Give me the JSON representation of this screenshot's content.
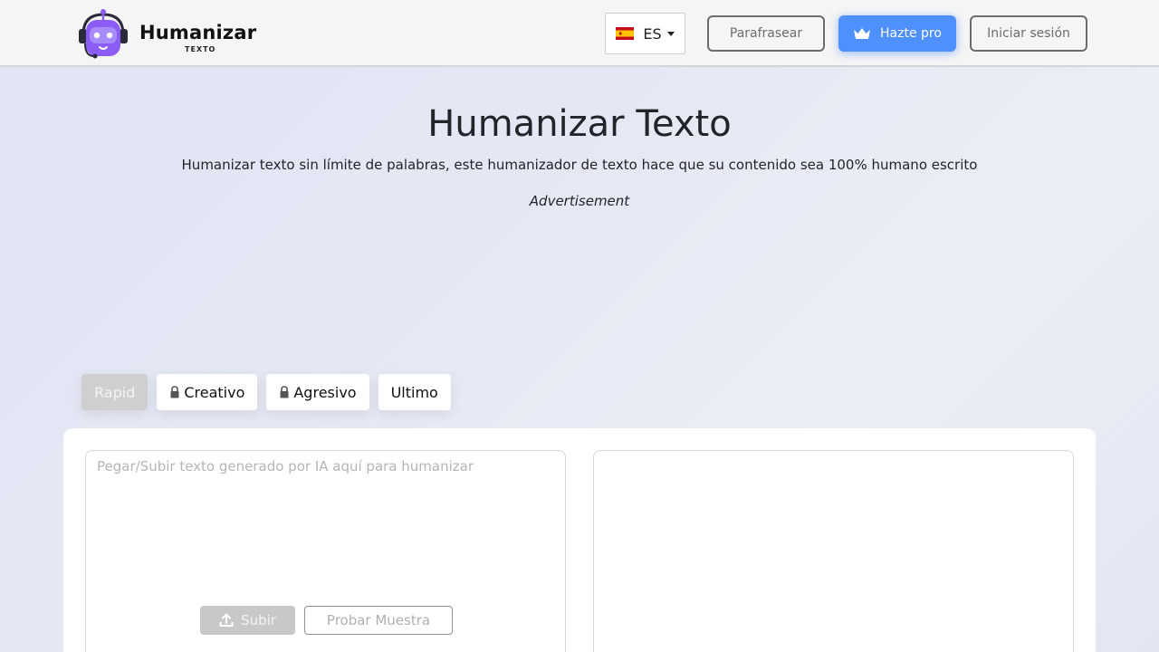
{
  "header": {
    "logo": {
      "name": "Humanizar",
      "subtitle": "TEXTO"
    },
    "language": {
      "code": "ES"
    },
    "paraphrase_label": "Parafrasear",
    "pro_label": "Hazte pro",
    "login_label": "Iniciar sesión"
  },
  "hero": {
    "title": "Humanizar Texto",
    "subtitle": "Humanizar texto sin límite de palabras, este humanizador de texto hace que su contenido sea 100% humano escrito",
    "ad_label": "Advertisement"
  },
  "modes": [
    {
      "label": "Rapid",
      "locked": false,
      "active": true
    },
    {
      "label": "Creativo",
      "locked": true,
      "active": false
    },
    {
      "label": "Agresivo",
      "locked": true,
      "active": false
    },
    {
      "label": "Ultimo",
      "locked": false,
      "active": false
    }
  ],
  "editor": {
    "input_placeholder": "Pegar/Subir texto generado por IA aquí para humanizar",
    "upload_label": "Subir",
    "sample_label": "Probar Muestra"
  },
  "colors": {
    "accent": "#4d90fe",
    "logo_purple": "#8b5cf6",
    "text": "#212529"
  }
}
